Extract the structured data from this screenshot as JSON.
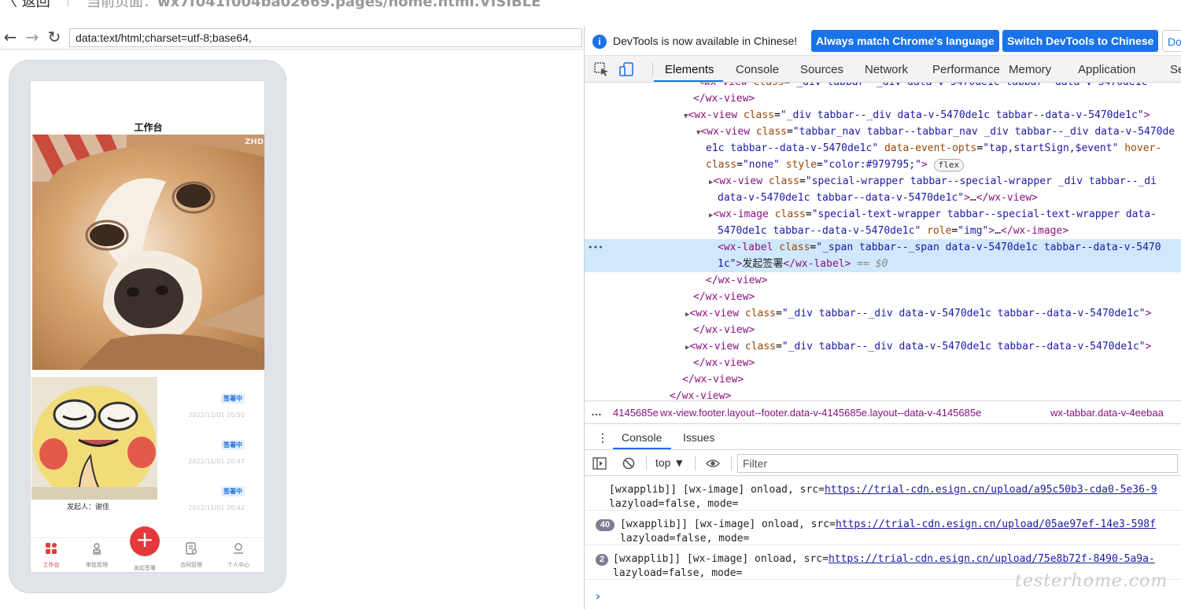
{
  "topbar": {
    "back_label": "返回",
    "current_page_prefix": "当前页面：",
    "current_page_value": "wx7f041f004ba02669.pages/home.html.VISIBLE"
  },
  "browser": {
    "url": "data:text/html;charset=utf-8;base64,"
  },
  "phone": {
    "page_title": "工作台",
    "image_watermark": "ZHD",
    "cards": [
      {
        "status": "签署中",
        "time": "2022/11/01 20:50"
      },
      {
        "status": "签署中",
        "time": "2022/11/01 20:47"
      },
      {
        "status": "签署中",
        "time": "2022/11/01 20:42"
      }
    ],
    "initiator": "发起人：谢佳",
    "tabs": [
      {
        "label": "工作台"
      },
      {
        "label": "审批管理"
      },
      {
        "label": "发起签署"
      },
      {
        "label": "合同管理"
      },
      {
        "label": "个人中心"
      }
    ],
    "fab_symbol": "+"
  },
  "devtools": {
    "info_text": "DevTools is now available in Chinese!",
    "btn_match": "Always match Chrome's language",
    "btn_switch": "Switch DevTools to Chinese",
    "btn_dont": "Don't show again",
    "tabs": [
      "Elements",
      "Console",
      "Sources",
      "Network",
      "Performance",
      "Memory",
      "Application",
      "Security"
    ],
    "active_tab": "Elements",
    "breadcrumbs": [
      "…",
      "4145685e",
      "wx-view.footer.layout--footer.data-v-4145685e.layout--data-v-4145685e",
      "wx-tabbar.data-v-4eebaa"
    ],
    "drawer_tabs": [
      "Console",
      "Issues"
    ],
    "context": "top",
    "filter_placeholder": "Filter",
    "console": [
      {
        "count": "",
        "line1": "[wxapplib]] [wx-image] onload, src=",
        "url": "https://trial-cdn.esign.cn/upload/a95c50b3-cda0-5e36-9",
        "line2": "lazyload=false, mode="
      },
      {
        "count": "40",
        "line1": "[wxapplib]] [wx-image] onload, src=",
        "url": "https://trial-cdn.esign.cn/upload/05ae97ef-14e3-598f",
        "line2": "lazyload=false, mode="
      },
      {
        "count": "2",
        "line1": "[wxapplib]] [wx-image] onload, src=",
        "url": "https://trial-cdn.esign.cn/upload/75e8b72f-8490-5a9a-",
        "line2": "lazyload=false, mode="
      }
    ],
    "elements_selected_text": "发起签署",
    "elements_eq": "== $0",
    "flex_badge": "flex"
  },
  "watermark": "testerhome.com"
}
